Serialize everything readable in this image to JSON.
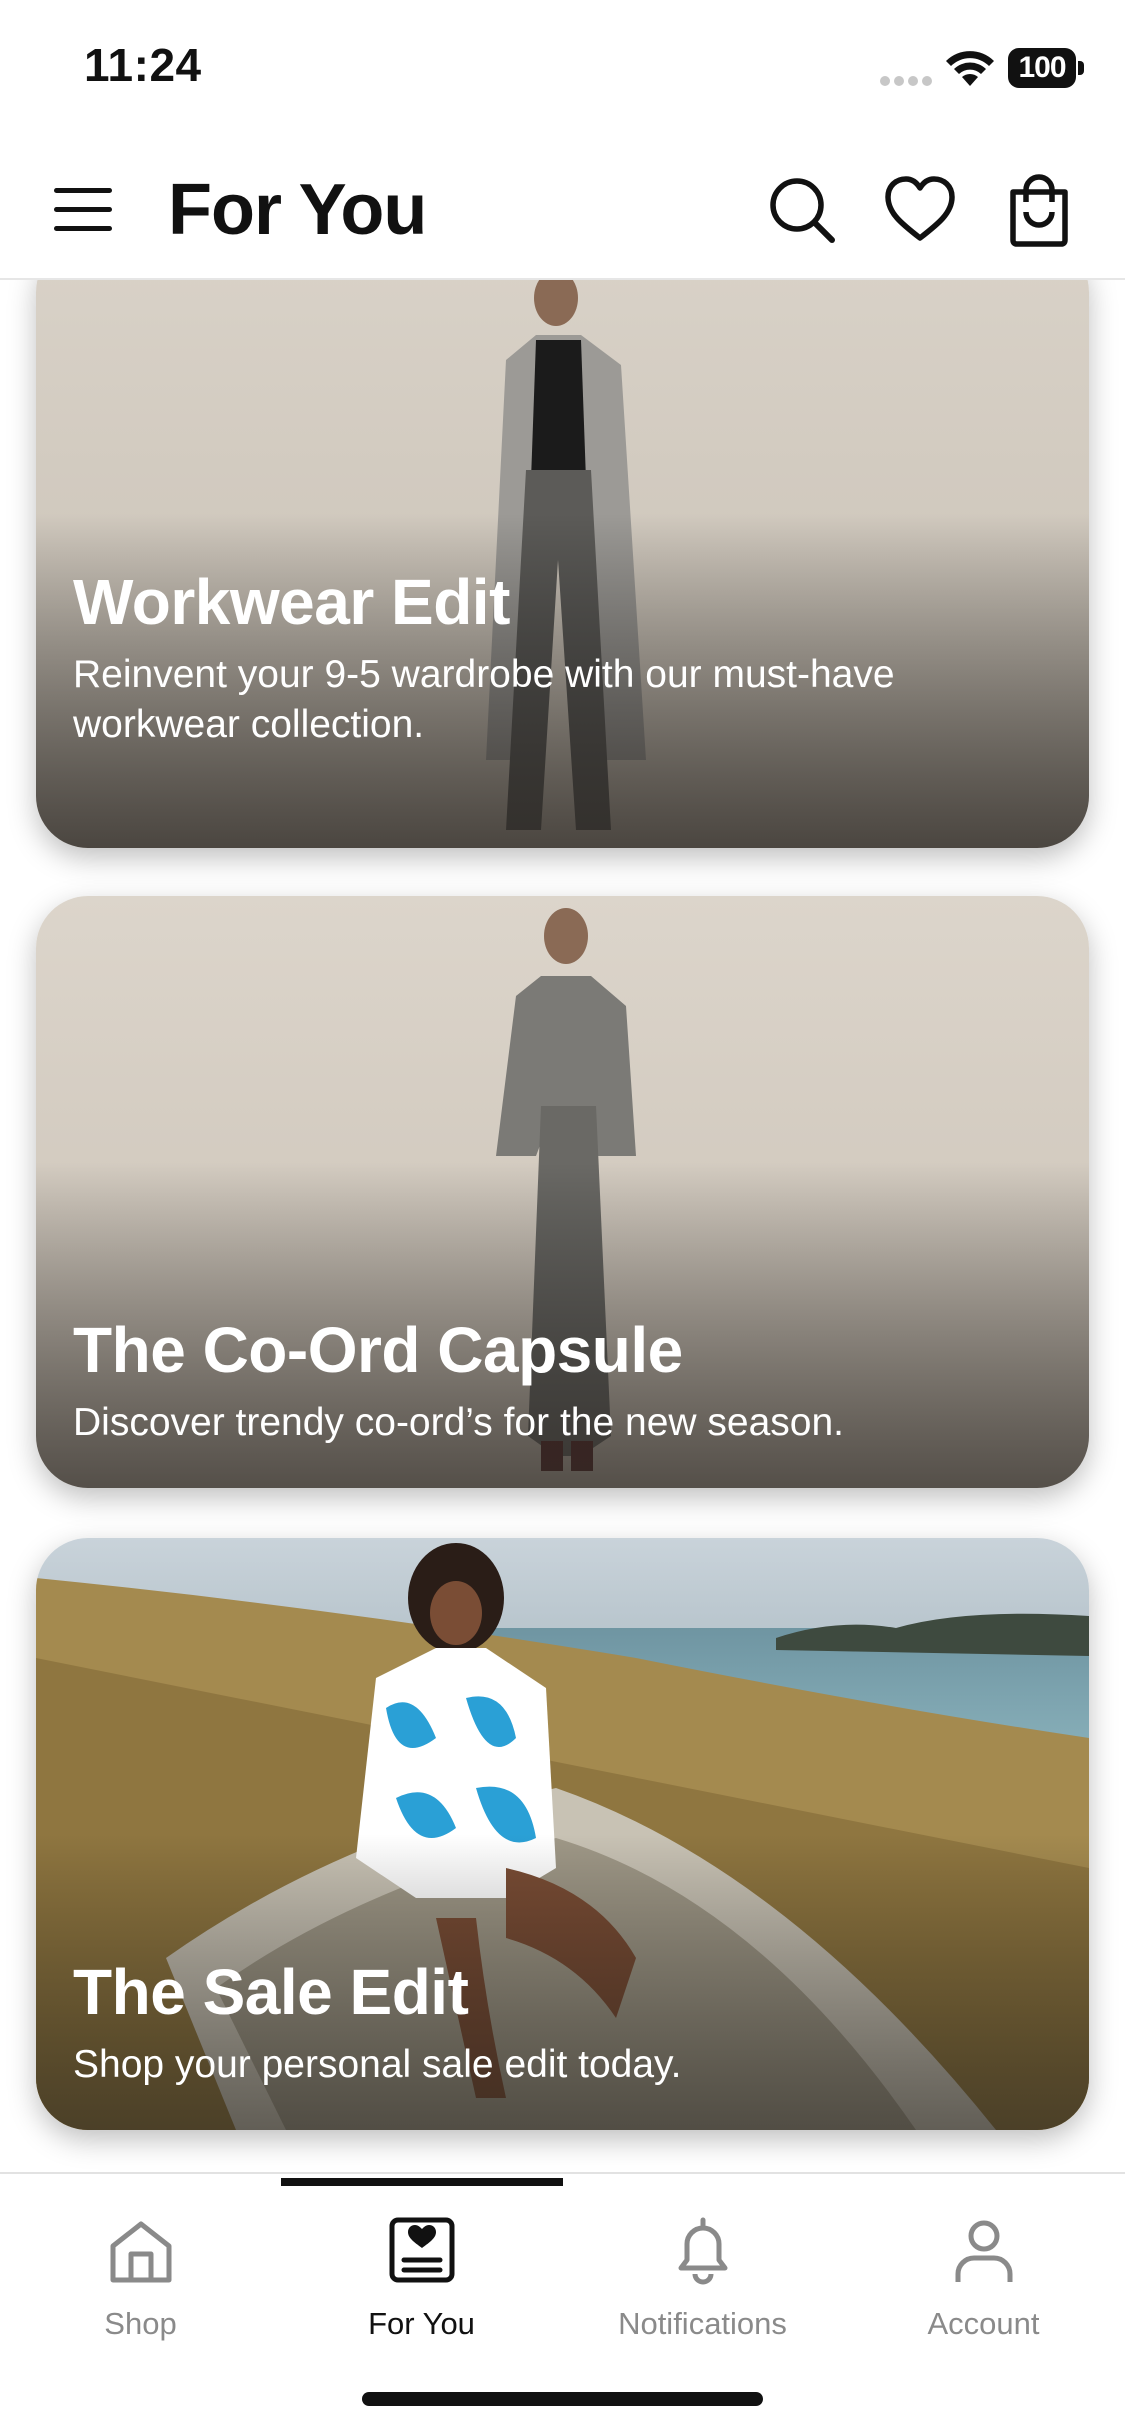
{
  "status_bar": {
    "time": "11:24",
    "battery": "100"
  },
  "header": {
    "title": "For You",
    "menu_icon": "hamburger-menu-icon",
    "search_icon": "search-icon",
    "wishlist_icon": "heart-icon",
    "bag_icon": "shopping-bag-icon"
  },
  "feed": {
    "cards": [
      {
        "title": "Workwear Edit",
        "subtitle": "Reinvent your 9-5 wardrobe with our must-have workwear collection."
      },
      {
        "title": "The Co-Ord Capsule",
        "subtitle": "Discover trendy co-ord’s for the new season."
      },
      {
        "title": "The Sale Edit",
        "subtitle": "Shop your personal sale edit today."
      }
    ]
  },
  "tab_bar": {
    "active_tab": "For You",
    "tabs": [
      {
        "label": "Shop",
        "icon": "home-icon"
      },
      {
        "label": "For You",
        "icon": "personalized-feed-icon"
      },
      {
        "label": "Notifications",
        "icon": "bell-icon"
      },
      {
        "label": "Account",
        "icon": "person-icon"
      }
    ]
  },
  "colors": {
    "text_primary": "#111111",
    "text_inactive": "#8a8a8a",
    "background": "#ffffff",
    "card_text": "#ffffff"
  }
}
